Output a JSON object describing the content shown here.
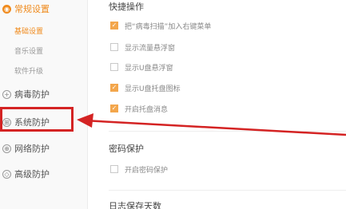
{
  "sidebar": {
    "groups": [
      {
        "label": "常规设置",
        "icon": "settings-icon",
        "glyph": "◉"
      },
      {
        "label": "病毒防护",
        "icon": "virus-shield-icon",
        "glyph": "+"
      },
      {
        "label": "系统防护",
        "icon": "system-shield-icon",
        "glyph": "⊞"
      },
      {
        "label": "网络防护",
        "icon": "globe-icon",
        "glyph": "⊕"
      },
      {
        "label": "高级防护",
        "icon": "advanced-shield-icon",
        "glyph": "◇"
      }
    ],
    "sub_items": [
      "基础设置",
      "音乐设置",
      "软件升级"
    ]
  },
  "main": {
    "quick_ops": {
      "title": "快捷操作",
      "options": [
        {
          "label": "把“病毒扫描”加入右键菜单",
          "checked": true
        },
        {
          "label": "显示流量悬浮窗",
          "checked": false
        },
        {
          "label": "显示U盘悬浮窗",
          "checked": false
        },
        {
          "label": "显示U盘托盘图标",
          "checked": true
        },
        {
          "label": "开启托盘消息",
          "checked": true
        }
      ]
    },
    "password": {
      "title": "密码保护",
      "options": [
        {
          "label": "开启密码保护",
          "checked": false
        }
      ]
    },
    "log": {
      "title": "日志保存天数"
    }
  },
  "colors": {
    "accent": "#f08a1c",
    "checkbox": "#f3a64c",
    "annotation": "#d42323"
  }
}
